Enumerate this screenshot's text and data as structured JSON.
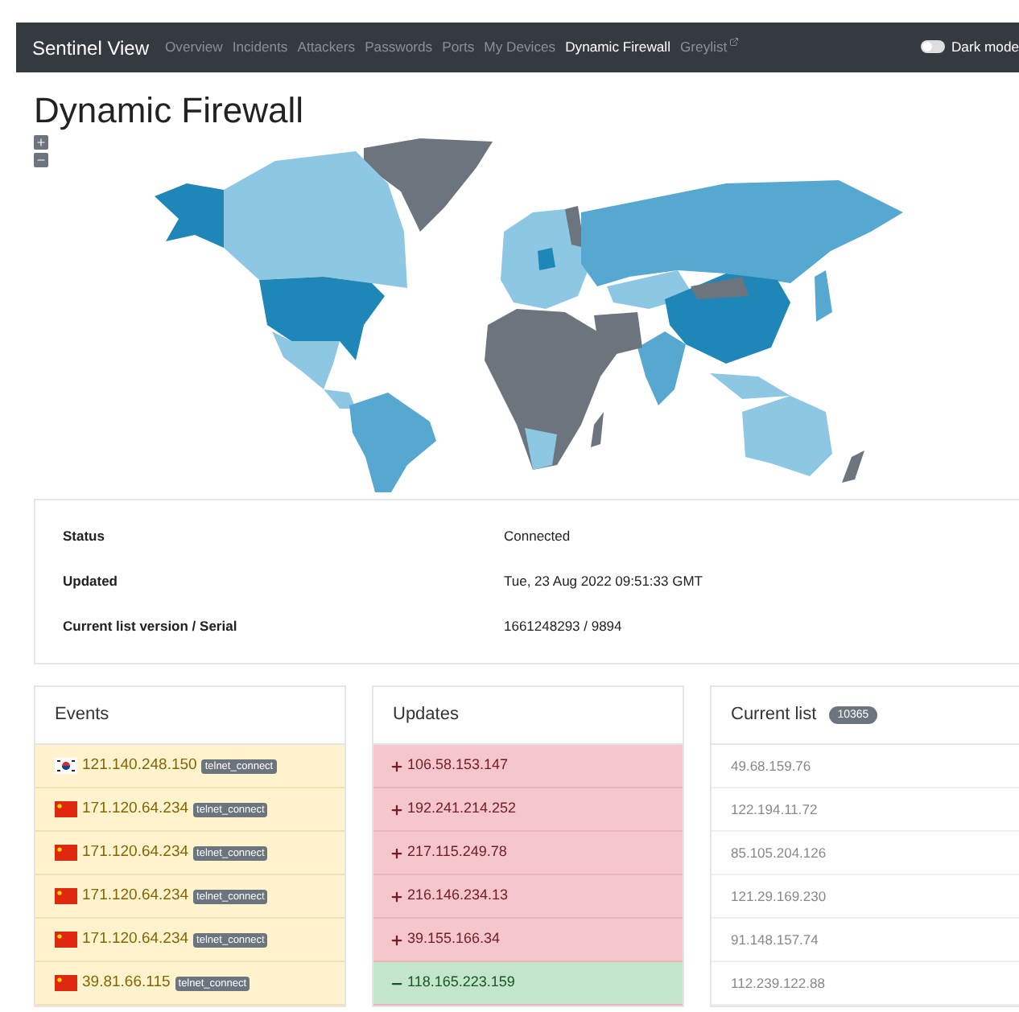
{
  "navbar": {
    "brand": "Sentinel View",
    "links": [
      {
        "label": "Overview",
        "selected": false,
        "external": false
      },
      {
        "label": "Incidents",
        "selected": false,
        "external": false
      },
      {
        "label": "Attackers",
        "selected": false,
        "external": false
      },
      {
        "label": "Passwords",
        "selected": false,
        "external": false
      },
      {
        "label": "Ports",
        "selected": false,
        "external": false
      },
      {
        "label": "My Devices",
        "selected": false,
        "external": false
      },
      {
        "label": "Dynamic Firewall",
        "selected": true,
        "external": false
      },
      {
        "label": "Greylist",
        "selected": false,
        "external": true
      }
    ],
    "dark_mode": {
      "label": "Dark mode",
      "on": false
    }
  },
  "page_title": "Dynamic Firewall",
  "status": [
    {
      "label": "Status",
      "value": "Connected"
    },
    {
      "label": "Updated",
      "value": "Tue, 23 Aug 2022 09:51:33 GMT"
    },
    {
      "label": "Current list version / Serial",
      "value": "1661248293 / 9894"
    }
  ],
  "events": {
    "title": "Events",
    "rows": [
      {
        "kind": "korea",
        "ip": "121.140.248.150",
        "tag": "telnet_connect"
      },
      {
        "kind": "china",
        "ip": "171.120.64.234",
        "tag": "telnet_connect"
      },
      {
        "kind": "china",
        "ip": "171.120.64.234",
        "tag": "telnet_connect"
      },
      {
        "kind": "china",
        "ip": "171.120.64.234",
        "tag": "telnet_connect"
      },
      {
        "kind": "china",
        "ip": "171.120.64.234",
        "tag": "telnet_connect"
      },
      {
        "kind": "china",
        "ip": "39.81.66.115",
        "tag": "telnet_connect"
      }
    ]
  },
  "updates": {
    "title": "Updates",
    "rows": [
      {
        "kind": "added",
        "ip": "106.58.153.147"
      },
      {
        "kind": "added",
        "ip": "192.241.214.252"
      },
      {
        "kind": "added",
        "ip": "217.115.249.78"
      },
      {
        "kind": "added",
        "ip": "216.146.234.13"
      },
      {
        "kind": "added",
        "ip": "39.155.166.34"
      },
      {
        "kind": "removed",
        "ip": "118.165.223.159"
      }
    ]
  },
  "current_list": {
    "title": "Current list",
    "count": "10365",
    "rows": [
      "49.68.159.76",
      "122.194.11.72",
      "85.105.204.126",
      "121.29.169.230",
      "91.148.157.74",
      "112.239.122.88"
    ]
  }
}
